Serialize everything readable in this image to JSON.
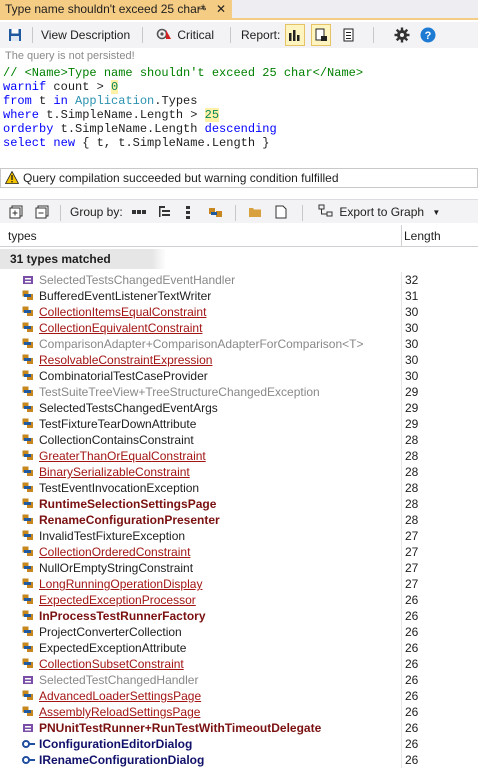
{
  "tab": {
    "title": "Type name shouldn't exceed 25 char*",
    "pin": "⊸",
    "close": "✕"
  },
  "toolbar": {
    "view_description": "View Description",
    "critical": "Critical",
    "report": "Report:"
  },
  "query_note": "The query is not persisted!",
  "code": {
    "line1_comment_open": "// <Name>",
    "line1_name": "Type name shouldn't exceed 25 char",
    "line1_comment_close": "</Name>",
    "line2_kw": "warnif",
    "line2_rest": " count > ",
    "line2_num": "0",
    "line3_kw1": "from",
    "line3_mid": " t ",
    "line3_kw2": "in",
    "line3_sp": " ",
    "line3_cls": "Application",
    "line3_rest": ".Types",
    "line4_kw": "where",
    "line4_rest": " t.SimpleName.Length > ",
    "line4_num": "25",
    "line5_kw": "orderby",
    "line5_mid": " t.SimpleName.Length ",
    "line5_kw2": "descending",
    "line6_kw1": "select",
    "line6_sp": " ",
    "line6_kw2": "new",
    "line6_rest": " { t, t.SimpleName.Length }"
  },
  "status_message": "Query compilation succeeded but warning condition fulfilled",
  "toolbar2": {
    "group_by": "Group by:",
    "export": "Export to Graph"
  },
  "columns": {
    "types": "types",
    "length": "Length"
  },
  "group_label": "31 types matched",
  "rows": [
    {
      "name": "SelectedTestsChangedEventHandler",
      "len": "32",
      "style": "gray",
      "icon": "delegate"
    },
    {
      "name": "BufferedEventListenerTextWriter",
      "len": "31",
      "style": "normal",
      "icon": "class"
    },
    {
      "name": "CollectionItemsEqualConstraint",
      "len": "30",
      "style": "link",
      "icon": "class"
    },
    {
      "name": "CollectionEquivalentConstraint",
      "len": "30",
      "style": "link",
      "icon": "class"
    },
    {
      "name": "ComparisonAdapter+ComparisonAdapterForComparison<T>",
      "len": "30",
      "style": "gray",
      "icon": "class"
    },
    {
      "name": "ResolvableConstraintExpression",
      "len": "30",
      "style": "link",
      "icon": "class"
    },
    {
      "name": "CombinatorialTestCaseProvider",
      "len": "30",
      "style": "normal",
      "icon": "class"
    },
    {
      "name": "TestSuiteTreeView+TreeStructureChangedException",
      "len": "29",
      "style": "gray",
      "icon": "class"
    },
    {
      "name": "SelectedTestsChangedEventArgs",
      "len": "29",
      "style": "normal",
      "icon": "class"
    },
    {
      "name": "TestFixtureTearDownAttribute",
      "len": "29",
      "style": "normal",
      "icon": "class"
    },
    {
      "name": "CollectionContainsConstraint",
      "len": "28",
      "style": "normal",
      "icon": "class"
    },
    {
      "name": "GreaterThanOrEqualConstraint",
      "len": "28",
      "style": "link",
      "icon": "class"
    },
    {
      "name": "BinarySerializableConstraint",
      "len": "28",
      "style": "link",
      "icon": "class"
    },
    {
      "name": "TestEventInvocationException",
      "len": "28",
      "style": "normal",
      "icon": "class"
    },
    {
      "name": "RuntimeSelectionSettingsPage",
      "len": "28",
      "style": "bold",
      "icon": "class"
    },
    {
      "name": "RenameConfigurationPresenter",
      "len": "28",
      "style": "bold",
      "icon": "class"
    },
    {
      "name": "InvalidTestFixtureException",
      "len": "27",
      "style": "normal",
      "icon": "class"
    },
    {
      "name": "CollectionOrderedConstraint",
      "len": "27",
      "style": "link",
      "icon": "class"
    },
    {
      "name": "NullOrEmptyStringConstraint",
      "len": "27",
      "style": "normal",
      "icon": "class"
    },
    {
      "name": "LongRunningOperationDisplay",
      "len": "27",
      "style": "link",
      "icon": "class"
    },
    {
      "name": "ExpectedExceptionProcessor",
      "len": "26",
      "style": "link",
      "icon": "class"
    },
    {
      "name": "InProcessTestRunnerFactory",
      "len": "26",
      "style": "bold",
      "icon": "class"
    },
    {
      "name": "ProjectConverterCollection",
      "len": "26",
      "style": "normal",
      "icon": "class"
    },
    {
      "name": "ExpectedExceptionAttribute",
      "len": "26",
      "style": "normal",
      "icon": "class"
    },
    {
      "name": "CollectionSubsetConstraint",
      "len": "26",
      "style": "link",
      "icon": "class"
    },
    {
      "name": "SelectedTestChangedHandler",
      "len": "26",
      "style": "gray",
      "icon": "delegate"
    },
    {
      "name": "AdvancedLoaderSettingsPage",
      "len": "26",
      "style": "link",
      "icon": "class"
    },
    {
      "name": "AssemblyReloadSettingsPage",
      "len": "26",
      "style": "link",
      "icon": "class"
    },
    {
      "name": "PNUnitTestRunner+RunTestWithTimeoutDelegate",
      "len": "26",
      "style": "bold",
      "icon": "delegate"
    },
    {
      "name": "IConfigurationEditorDialog",
      "len": "26",
      "style": "boldblue",
      "icon": "interface"
    },
    {
      "name": "IRenameConfigurationDialog",
      "len": "26",
      "style": "boldblue",
      "icon": "interface"
    }
  ]
}
